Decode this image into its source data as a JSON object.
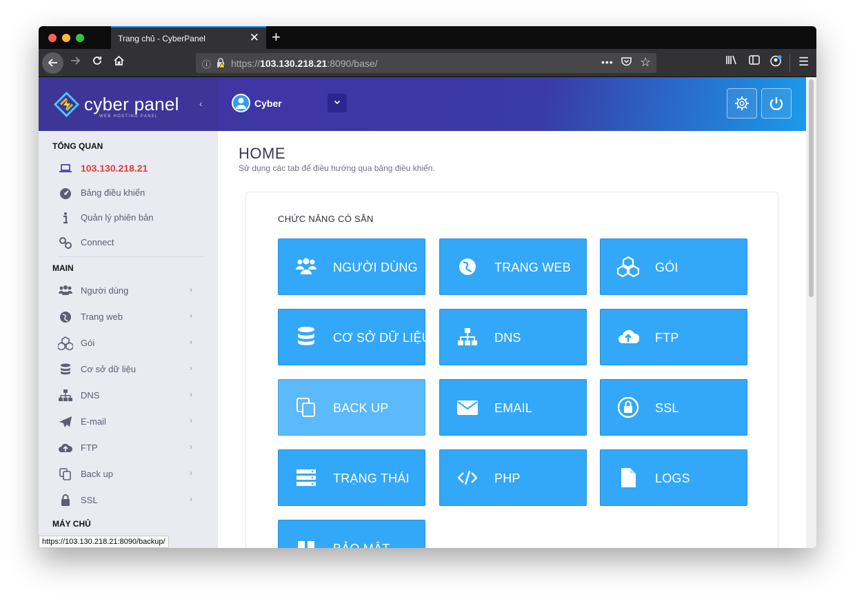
{
  "browser": {
    "tab_title": "Trang chủ - CyberPanel",
    "tab_close": "✕",
    "new_tab": "+",
    "url_prefix": "https://",
    "url_host": "103.130.218.21",
    "url_rest": ":8090/base/",
    "url_menu": "•••",
    "status_url": "https://103.130.218.21:8090/backup/"
  },
  "logo": {
    "text": "cyber panel",
    "sub": "WEB HOSTING PANEL",
    "collapse": "‹"
  },
  "header": {
    "user_name": "Cyber",
    "dropdown": "⌄"
  },
  "sidebar": {
    "overview_title": "TỔNG QUAN",
    "overview_items": [
      {
        "label": "103.130.218.21",
        "icon": "laptop-icon"
      },
      {
        "label": "Bảng điều khiển",
        "icon": "dashboard-icon"
      },
      {
        "label": "Quản lý phiên bản",
        "icon": "info-icon"
      },
      {
        "label": "Connect",
        "icon": "link-icon"
      }
    ],
    "main_title": "MAIN",
    "main_items": [
      {
        "label": "Người dùng",
        "icon": "users-icon"
      },
      {
        "label": "Trang web",
        "icon": "globe-icon"
      },
      {
        "label": "Gói",
        "icon": "cubes-icon"
      },
      {
        "label": "Cơ sở dữ liệu",
        "icon": "database-icon"
      },
      {
        "label": "DNS",
        "icon": "sitemap-icon"
      },
      {
        "label": "E-mail",
        "icon": "paper-plane-icon"
      },
      {
        "label": "FTP",
        "icon": "cloud-upload-icon"
      },
      {
        "label": "Back up",
        "icon": "copy-icon"
      },
      {
        "label": "SSL",
        "icon": "lock-icon"
      }
    ],
    "server_title": "MÁY CHỦ",
    "chevron": "›"
  },
  "content": {
    "title": "HOME",
    "subtitle": "Sử dụng các tab để điều hướng qua bảng điều khiển.",
    "card_title": "CHỨC NĂNG CÓ SẴN",
    "tiles": [
      {
        "label": "NGƯỜI DÙNG",
        "icon": "users-icon"
      },
      {
        "label": "TRANG WEB",
        "icon": "globe-icon"
      },
      {
        "label": "GÓI",
        "icon": "cubes-icon"
      },
      {
        "label": "CƠ SỞ DỮ LIỆU",
        "icon": "database-icon"
      },
      {
        "label": "DNS",
        "icon": "sitemap-icon"
      },
      {
        "label": "FTP",
        "icon": "cloud-upload-icon"
      },
      {
        "label": "BACK UP",
        "icon": "copy-icon"
      },
      {
        "label": "EMAIL",
        "icon": "envelope-icon"
      },
      {
        "label": "SSL",
        "icon": "lock-icon"
      },
      {
        "label": "TRẠNG THÁI",
        "icon": "server-icon"
      },
      {
        "label": "PHP",
        "icon": "code-icon"
      },
      {
        "label": "LOGS",
        "icon": "file-icon"
      },
      {
        "label": "BẢO MẬT",
        "icon": "shield-icon"
      }
    ]
  },
  "colors": {
    "sidebar_bg": "#e9ebf1",
    "logo_bg": "#3d3597",
    "tile_bg": "#33a8f8",
    "active_link": "#e23b3b"
  }
}
